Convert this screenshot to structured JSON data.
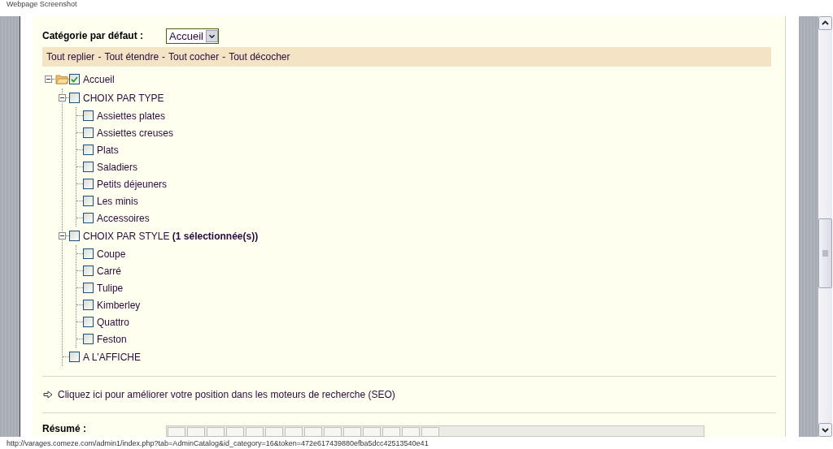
{
  "header": {
    "title": "Webpage Screenshot"
  },
  "category": {
    "label": "Catégorie par défaut :",
    "value": "Accueil"
  },
  "tree_actions": {
    "links": [
      "Tout replier",
      "Tout étendre",
      "Tout cocher",
      "Tout décocher"
    ],
    "separator": "-"
  },
  "tree": [
    {
      "label": "Accueil",
      "kind": "folder",
      "checked": true,
      "expanded": true,
      "children": [
        {
          "label": "CHOIX PAR TYPE",
          "checked": false,
          "expanded": true,
          "children": [
            {
              "label": "Assiettes plates",
              "checked": false
            },
            {
              "label": "Assiettes creuses",
              "checked": false
            },
            {
              "label": "Plats",
              "checked": false
            },
            {
              "label": "Saladiers",
              "checked": false
            },
            {
              "label": "Petits déjeuners",
              "checked": false
            },
            {
              "label": "Les minis",
              "checked": false
            },
            {
              "label": "Accessoires",
              "checked": false
            }
          ]
        },
        {
          "label": "CHOIX PAR STYLE **(1 sélectionnée(s))**",
          "checked": false,
          "expanded": true,
          "children": [
            {
              "label": "Coupe",
              "checked": false
            },
            {
              "label": "Carré",
              "checked": false
            },
            {
              "label": "Tulipe",
              "checked": false
            },
            {
              "label": "Kimberley",
              "checked": false
            },
            {
              "label": "Quattro",
              "checked": false
            },
            {
              "label": "Feston",
              "checked": false
            }
          ]
        },
        {
          "label": "A L'AFFICHE",
          "checked": false
        }
      ]
    }
  ],
  "seo_link": "Cliquez ici pour améliorer votre position dans les moteurs de recherche (SEO)",
  "summary": {
    "label": "Résumé :"
  },
  "status_bar": {
    "url": "http://varages.comeze.com/admin1/index.php?tab=AdminCatalog&id_category=16&token=472e617439880efba5dcc42513540e41"
  }
}
